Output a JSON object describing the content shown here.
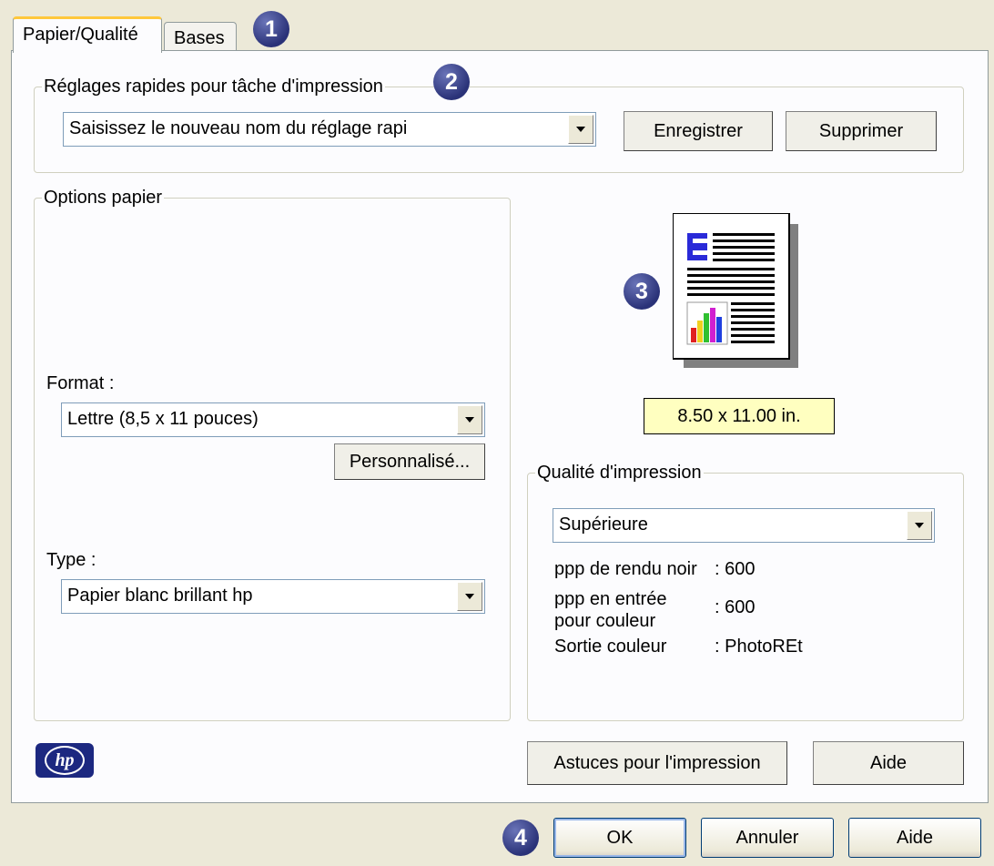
{
  "tabs": [
    {
      "label": "Papier/Qualité",
      "active": true
    },
    {
      "label": "Bases",
      "active": false
    }
  ],
  "badges": [
    "1",
    "2",
    "3",
    "4"
  ],
  "quick_settings": {
    "legend": "Réglages rapides pour tâche d'impression",
    "input_value": "Saisissez le nouveau nom du réglage rapi",
    "save_label": "Enregistrer",
    "delete_label": "Supprimer"
  },
  "paper_options": {
    "legend": "Options papier",
    "format_label": "Format :",
    "format_value": "Lettre (8,5 x 11 pouces)",
    "custom_label": "Personnalisé...",
    "type_label": "Type :",
    "type_value": "Papier blanc brillant hp"
  },
  "preview": {
    "size_label": "8.50 x 11.00 in.",
    "icon": "page-preview-icon"
  },
  "print_quality": {
    "legend": "Qualité d'impression",
    "value": "Supérieure",
    "rows": [
      {
        "label": "ppp de rendu noir",
        "value": ": 600"
      },
      {
        "label": "ppp en entrée\npour couleur",
        "value": ": 600"
      },
      {
        "label": "Sortie couleur",
        "value": ": PhotoREt"
      }
    ]
  },
  "footer": {
    "logo_text": "hp",
    "tips_label": "Astuces pour l'impression",
    "help_label": "Aide"
  },
  "dialog_buttons": {
    "ok": "OK",
    "cancel": "Annuler",
    "help": "Aide"
  },
  "colors": {
    "accent_tab": "#ffc83c",
    "badge": "#2a3278",
    "size_label_bg": "#ffffc0"
  }
}
